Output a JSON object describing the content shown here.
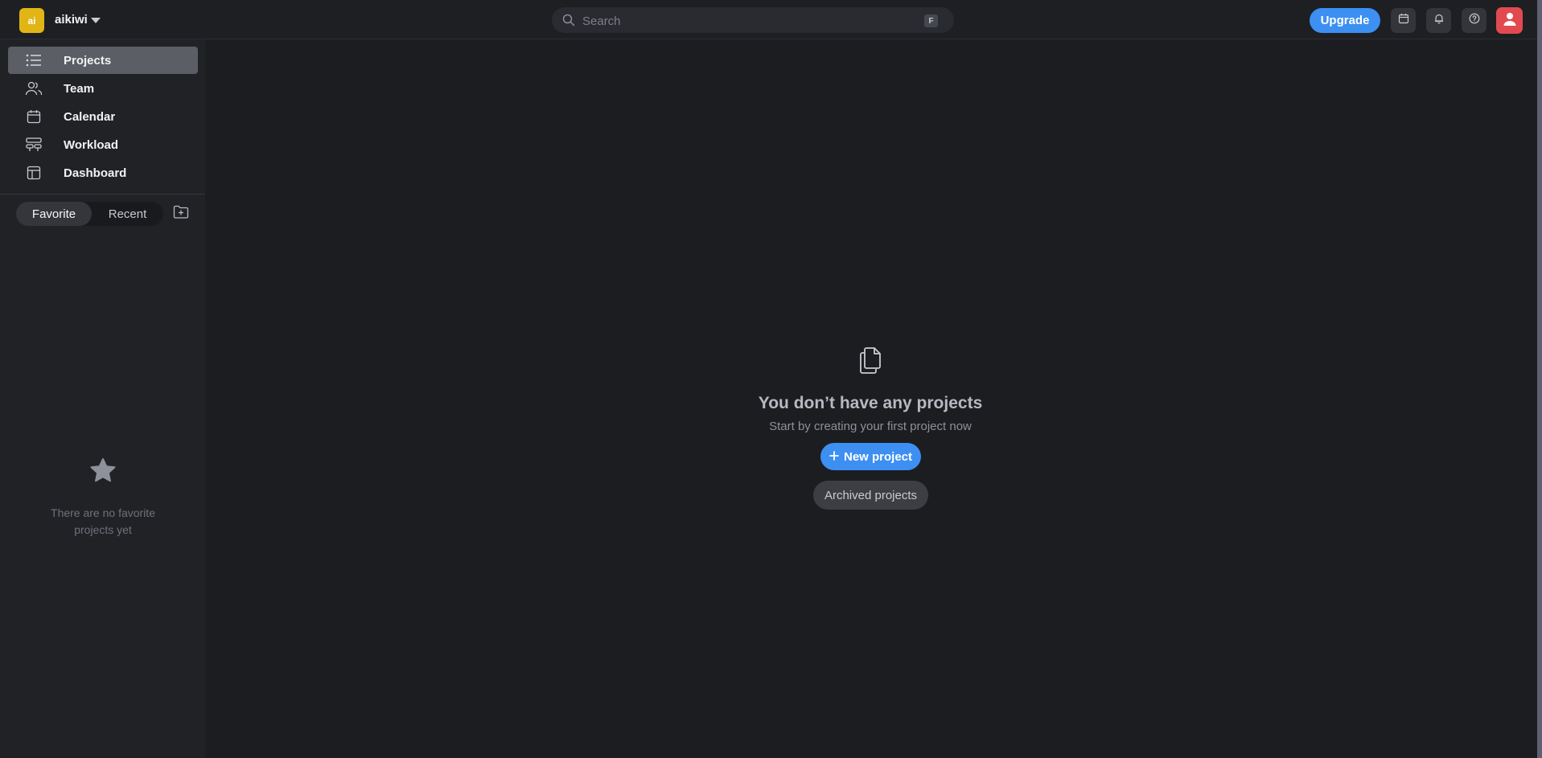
{
  "workspace": {
    "logo_text": "ai",
    "name": "aikiwi",
    "logo_color": "#e1b515"
  },
  "search": {
    "placeholder": "Search",
    "shortcut": "F"
  },
  "header": {
    "upgrade_label": "Upgrade",
    "accent": "#3d8ff2",
    "avatar_color": "#e24a4f"
  },
  "sidebar": {
    "items": [
      {
        "label": "Projects",
        "icon": "list-icon",
        "active": true
      },
      {
        "label": "Team",
        "icon": "users-icon"
      },
      {
        "label": "Calendar",
        "icon": "calendar-icon"
      },
      {
        "label": "Workload",
        "icon": "workload-icon"
      },
      {
        "label": "Dashboard",
        "icon": "dashboard-icon"
      }
    ],
    "tabs": {
      "favorite": "Favorite",
      "recent": "Recent",
      "selected": "Favorite"
    },
    "empty_text": "There are no favorite projects yet"
  },
  "main": {
    "empty_title": "You don’t have any projects",
    "empty_subtitle": "Start by creating your first project now",
    "new_project_label": "New project",
    "archived_label": "Archived projects"
  }
}
